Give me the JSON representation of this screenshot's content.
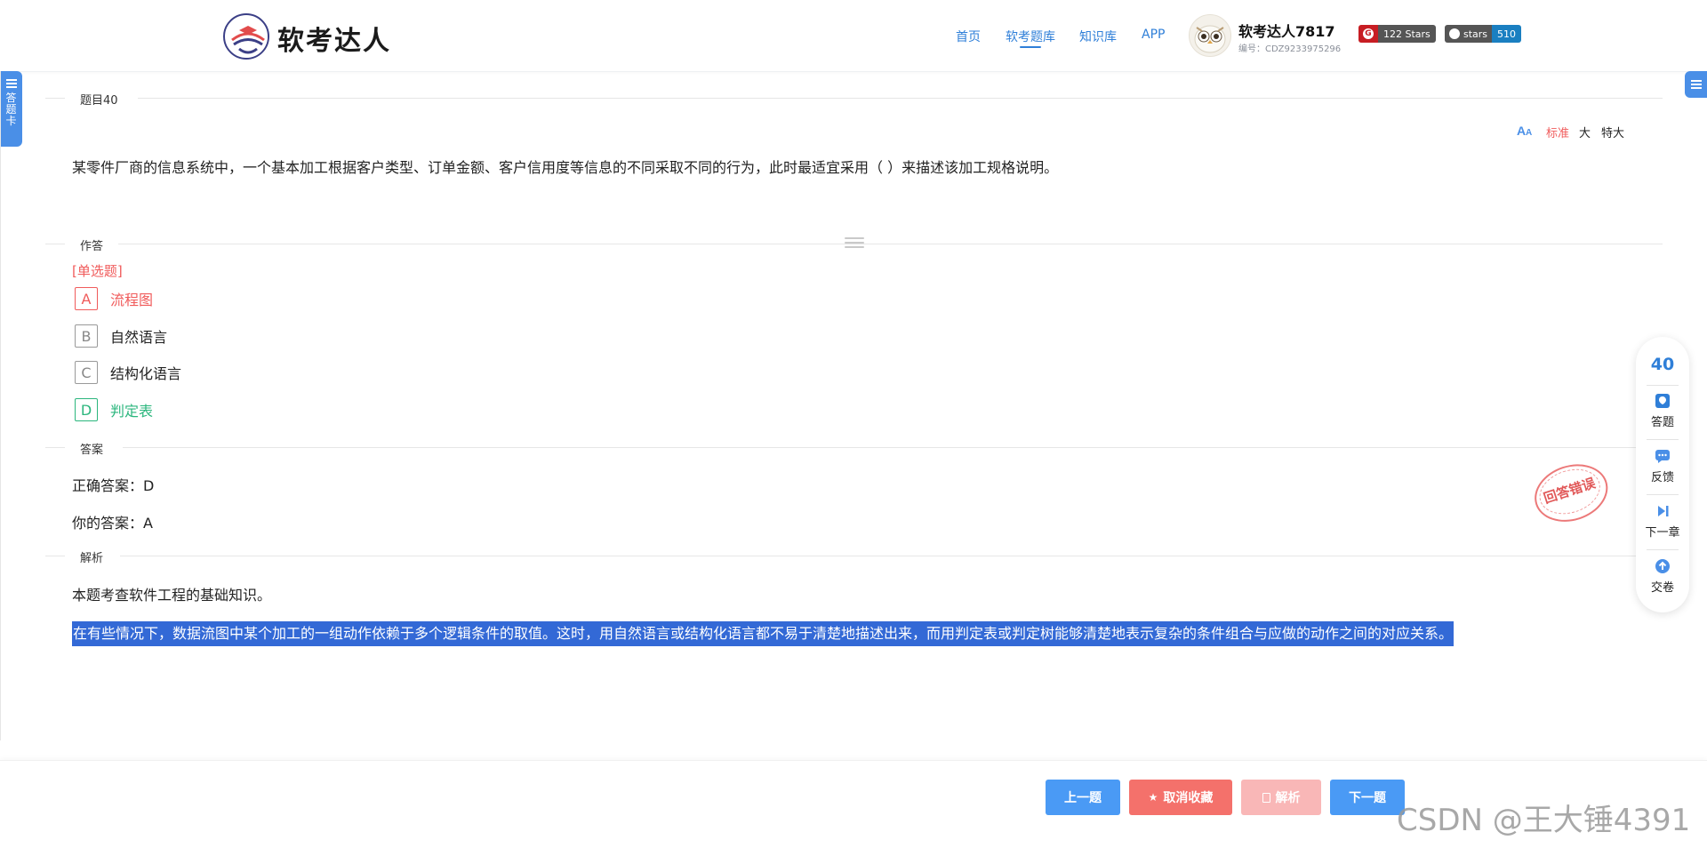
{
  "header": {
    "logo_text": "软考达人",
    "nav": [
      "首页",
      "软考题库",
      "知识库",
      "APP"
    ],
    "user_name": "软考达人7817",
    "user_id": "编号：CDZ9233975296",
    "gitee_badge": "122 Stars",
    "github_badge_left": "stars",
    "github_badge_right": "510"
  },
  "left_tab": {
    "label": "答题卡"
  },
  "question": {
    "section_title": "题目40",
    "font_sizes": [
      "标准",
      "大",
      "特大"
    ],
    "font_size_selected": "标准",
    "text": "某零件厂商的信息系统中，一个基本加工根据客户类型、订单金额、客户信用度等信息的不同采取不同的行为，此时最适宜采用（ ）来描述该加工规格说明。"
  },
  "answer_area": {
    "section_title": "作答",
    "type": "[单选题]",
    "options": [
      {
        "letter": "A",
        "text": "流程图",
        "state": "wrong-selected"
      },
      {
        "letter": "B",
        "text": "自然语言",
        "state": "normal"
      },
      {
        "letter": "C",
        "text": "结构化语言",
        "state": "normal"
      },
      {
        "letter": "D",
        "text": "判定表",
        "state": "correct"
      }
    ]
  },
  "answer": {
    "section_title": "答案",
    "correct": "正确答案：D",
    "yours": "你的答案：A",
    "stamp": "回答错误"
  },
  "explanation": {
    "section_title": "解析",
    "line1": "本题考查软件工程的基础知识。",
    "line2": "在有些情况下，数据流图中某个加工的一组动作依赖于多个逻辑条件的取值。这时，用自然语言或结构化语言都不易于清楚地描述出来，而用判定表或判定树能够清楚地表示复杂的条件组合与应做的动作之间的对应关系。"
  },
  "float_panel": {
    "number": "40",
    "items": [
      "答题",
      "反馈",
      "下一章",
      "交卷"
    ]
  },
  "bottom": {
    "prev": "上一题",
    "unfav": "取消收藏",
    "analysis": "解析",
    "next": "下一题"
  },
  "watermark": "CSDN @王大锤4391",
  "colors": {
    "primary": "#4a9af5",
    "red": "#f05b5b",
    "green": "#2bb67d",
    "fav": "#f4716b",
    "analysis_disabled": "#f9b7b7"
  }
}
